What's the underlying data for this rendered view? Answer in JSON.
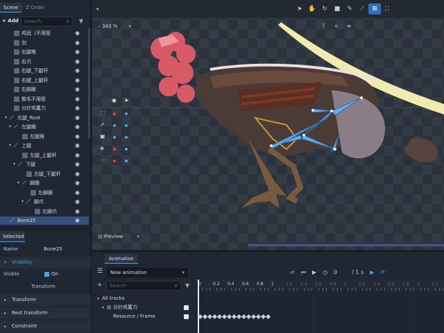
{
  "scene": {
    "tabs": [
      "Scene",
      "Z Order"
    ],
    "add_label": "+ Add",
    "search_placeholder": "Search",
    "tree": [
      {
        "label": "鸡冠（不用管",
        "type": "slot",
        "indent": 2,
        "arrow": ""
      },
      {
        "label": "剑",
        "type": "slot",
        "indent": 2,
        "arrow": ""
      },
      {
        "label": "右腿根",
        "type": "slot",
        "indent": 2,
        "arrow": ""
      },
      {
        "label": "右爪",
        "type": "slot",
        "indent": 2,
        "arrow": ""
      },
      {
        "label": "右腿_下腿杆",
        "type": "slot",
        "indent": 2,
        "arrow": ""
      },
      {
        "label": "右腿_上腿杆",
        "type": "slot",
        "indent": 2,
        "arrow": ""
      },
      {
        "label": "右脚跟",
        "type": "slot",
        "indent": 2,
        "arrow": ""
      },
      {
        "label": "鬃毛不用管",
        "type": "slot",
        "indent": 2,
        "arrow": ""
      },
      {
        "label": "分针鸡蓄力",
        "type": "slot",
        "indent": 2,
        "arrow": ""
      },
      {
        "label": "左腿_Root",
        "type": "bone",
        "indent": 1,
        "arrow": "▾"
      },
      {
        "label": "左腿跟",
        "type": "bone",
        "indent": 2,
        "arrow": "▾"
      },
      {
        "label": "左腿根",
        "type": "slot",
        "indent": 4,
        "arrow": ""
      },
      {
        "label": "上腿",
        "type": "bone",
        "indent": 2,
        "arrow": "▾"
      },
      {
        "label": "左腿_上腿杆",
        "type": "slot",
        "indent": 4,
        "arrow": ""
      },
      {
        "label": "下腿",
        "type": "bone",
        "indent": 3,
        "arrow": "▾"
      },
      {
        "label": "左腿_下腿杆",
        "type": "slot",
        "indent": 5,
        "arrow": ""
      },
      {
        "label": "脚跟",
        "type": "bone",
        "indent": 4,
        "arrow": "▾"
      },
      {
        "label": "左脚跟",
        "type": "slot",
        "indent": 6,
        "arrow": ""
      },
      {
        "label": "脚爪",
        "type": "bone",
        "indent": 5,
        "arrow": "▾"
      },
      {
        "label": "左脚爪",
        "type": "slot",
        "indent": 7,
        "arrow": ""
      },
      {
        "label": "Bone25",
        "type": "bone",
        "indent": 1,
        "arrow": "",
        "selected": true
      }
    ]
  },
  "selected": {
    "title": "Selected",
    "name_label": "Name",
    "name_value": "Bone25",
    "visibility_section": "Visibility",
    "visible_label": "Visible",
    "visible_value": "On",
    "transform_heading": "Transform",
    "sections": [
      "Transform",
      "Rest transform",
      "Constraint"
    ]
  },
  "viewport": {
    "zoom": "343 %",
    "preview_label": "Preview",
    "tools": [
      "pointer",
      "hand",
      "rotate",
      "scale",
      "pen",
      "bone",
      "weights",
      "frame"
    ],
    "active_tool_index": 6
  },
  "layers": [
    {
      "icon": "select-icon",
      "c1": "#e0474c",
      "c2": "#4aa8f0"
    },
    {
      "icon": "bone-icon",
      "c1": "#4aa8f0",
      "c2": "#4aa8f0"
    },
    {
      "icon": "image-icon",
      "c1": "#4aa8f0",
      "c2": "#4aa8f0"
    },
    {
      "icon": "layers-icon",
      "c1": "#e0474c",
      "c2": "#4aa8f0"
    },
    {
      "icon": "more-icon",
      "c1": "#e0474c",
      "c2": "#4aa8f0"
    }
  ],
  "animation": {
    "tab": "Animation",
    "current": "New animation",
    "frame": "0",
    "duration": "/ 1 s",
    "search_placeholder": "Search",
    "all_tracks": "All tracks",
    "track_group": "分针鸡蓄力",
    "track_item": "Resource / Frame",
    "ruler": [
      "0",
      "0.2",
      "0.4",
      "0.6",
      "0.8",
      "1",
      "1.2",
      "1.4",
      "1.6",
      "1.8",
      "2",
      "2.2",
      "2.4",
      "2.6",
      "2.8",
      "3",
      "3.2"
    ]
  },
  "colors": {
    "accent": "#4aa8f0",
    "selection": "#36507a",
    "red_dot": "#e0474c"
  }
}
